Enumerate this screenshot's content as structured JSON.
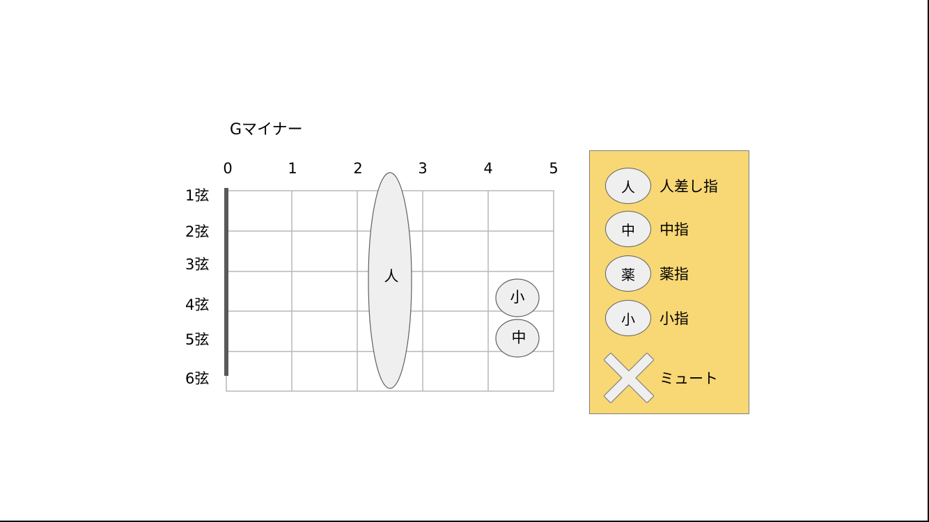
{
  "title": "Gマイナー",
  "frets": [
    "0",
    "1",
    "2",
    "3",
    "4",
    "5"
  ],
  "strings": [
    "1弦",
    "2弦",
    "3弦",
    "4弦",
    "5弦",
    "6弦"
  ],
  "fingers": {
    "barre": "人",
    "pinky": "小",
    "middle": "中"
  },
  "legend": {
    "items": [
      {
        "symbol": "人",
        "label": "人差し指"
      },
      {
        "symbol": "中",
        "label": "中指"
      },
      {
        "symbol": "薬",
        "label": "薬指"
      },
      {
        "symbol": "小",
        "label": "小指"
      }
    ],
    "mute_label": "ミュート"
  },
  "colors": {
    "legend_background": "#f8d775",
    "finger_fill": "#efefef",
    "nut": "#595959",
    "grid": "#b7b7b7"
  }
}
